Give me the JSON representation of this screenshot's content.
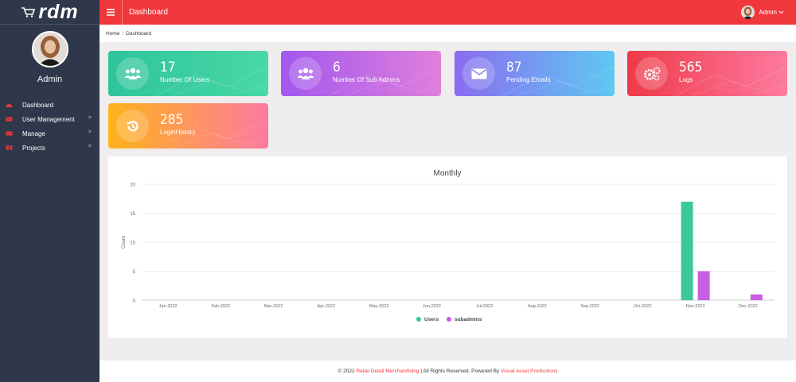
{
  "brand": {
    "logo_text": "rdm"
  },
  "profile": {
    "name": "Admin"
  },
  "sidebar": {
    "items": [
      {
        "label": "Dashboard",
        "icon": "dashboard-icon",
        "has_submenu": false
      },
      {
        "label": "User Management",
        "icon": "users-icon",
        "has_submenu": true
      },
      {
        "label": "Manage",
        "icon": "manage-icon",
        "has_submenu": true
      },
      {
        "label": "Projects",
        "icon": "projects-icon",
        "has_submenu": true
      }
    ]
  },
  "header": {
    "title": "Dashboard",
    "user_label": "Admin"
  },
  "breadcrumb": {
    "home": "Home",
    "current": "Dashboard"
  },
  "cards": [
    {
      "value": "17",
      "label": "Number Of Users",
      "icon": "users-icon"
    },
    {
      "value": "6",
      "label": "Number Of Sub Admins",
      "icon": "sub-admins-icon"
    },
    {
      "value": "87",
      "label": "Pending Emails",
      "icon": "envelope-icon"
    },
    {
      "value": "565",
      "label": "Logs",
      "icon": "gears-icon"
    },
    {
      "value": "285",
      "label": "LoginHistory",
      "icon": "history-icon"
    }
  ],
  "colors": {
    "header": "#f0373c",
    "sidebar": "#2f374a",
    "users_series": "#3cc99a",
    "subadmins_series": "#c75fe3"
  },
  "chart_data": {
    "type": "bar",
    "title": "Monthly",
    "xlabel": "",
    "ylabel": "Count",
    "ylim": [
      0,
      20
    ],
    "yticks": [
      0,
      5,
      10,
      15,
      20
    ],
    "categories": [
      "Jan-2022",
      "Feb-2022",
      "Mar-2022",
      "Apr-2022",
      "May-2022",
      "Jun-2022",
      "Jul-2022",
      "Aug-2022",
      "Sep-2022",
      "Oct-2022",
      "Nov-2022",
      "Dec-2022"
    ],
    "series": [
      {
        "name": "Users",
        "color": "#3cc99a",
        "values": [
          0,
          0,
          0,
          0,
          0,
          0,
          0,
          0,
          0,
          0,
          17,
          0
        ]
      },
      {
        "name": "subadmins",
        "color": "#c75fe3",
        "values": [
          0,
          0,
          0,
          0,
          0,
          0,
          0,
          0,
          0,
          0,
          5,
          1
        ]
      }
    ],
    "legend_position": "bottom",
    "grid": true
  },
  "footer": {
    "prefix": "© 2022 ",
    "company": "Retail Detail Merchandising",
    "middle": " | All Rights Reserved. Powered By ",
    "powered": "Visual Asset Productions"
  }
}
